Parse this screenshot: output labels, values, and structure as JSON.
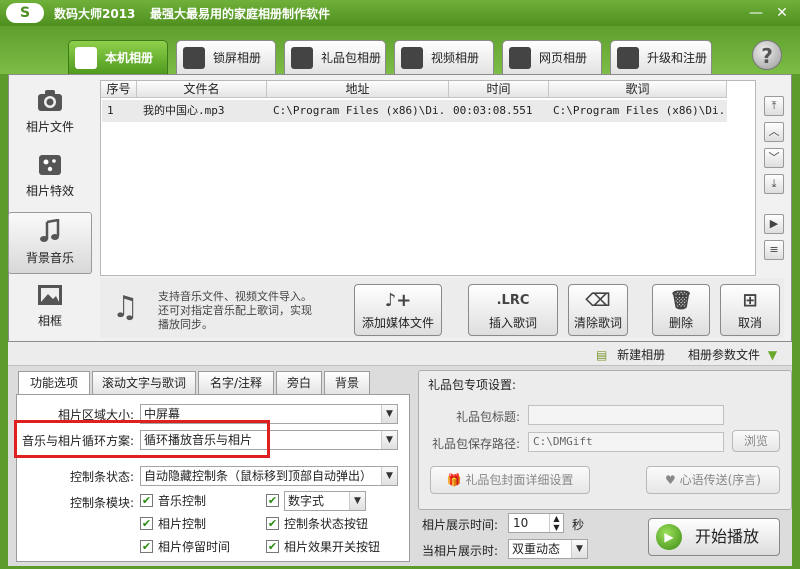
{
  "window": {
    "title": "数码大师2013",
    "slogan": "最强大最易用的家庭相册制作软件",
    "logo_text": "S",
    "minimize": "—",
    "close": "✕"
  },
  "main_tabs": [
    {
      "label": "本机相册",
      "icon": "user-photo-icon"
    },
    {
      "label": "锁屏相册",
      "icon": "monitor-icon"
    },
    {
      "label": "礼品包相册",
      "icon": "gift-icon"
    },
    {
      "label": "视频相册",
      "icon": "film-icon"
    },
    {
      "label": "网页相册",
      "icon": "ie-icon"
    },
    {
      "label": "升级和注册",
      "icon": "globe-icon"
    }
  ],
  "help_label": "?",
  "sidebar": [
    {
      "label": "相片文件",
      "icon": "camera-icon"
    },
    {
      "label": "相片特效",
      "icon": "effects-icon"
    },
    {
      "label": "背景音乐",
      "icon": "music-note-icon"
    },
    {
      "label": "相框",
      "icon": "picture-frame-icon"
    }
  ],
  "table": {
    "columns": [
      "序号",
      "文件名",
      "地址",
      "时间",
      "歌词"
    ],
    "rows": [
      [
        "1",
        "我的中国心.mp3",
        "C:\\Program Files (x86)\\Di...",
        "00:03:08.551",
        "C:\\Program Files (x86)\\Di..."
      ]
    ]
  },
  "side_arrows": [
    "⤒",
    "︿",
    "﹀",
    "⤓",
    "▶",
    "≡"
  ],
  "info_text": [
    "支持音乐文件、视频文件导入。",
    "还可对指定音乐配上歌词，实现",
    "播放同步。"
  ],
  "actions": [
    {
      "label": "添加媒体文件",
      "icon": "add-music-icon",
      "glyph": "♪+"
    },
    {
      "label": "插入歌词",
      "icon": "lrc-icon",
      "glyph": ".LRC"
    },
    {
      "label": "清除歌词",
      "icon": "eraser-icon",
      "glyph": "⌫"
    },
    {
      "label": "删除",
      "icon": "trash-icon",
      "glyph": "🗑"
    },
    {
      "label": "取消",
      "icon": "grid-icon",
      "glyph": "⊞"
    }
  ],
  "toolstrip": {
    "new_album": "新建相册",
    "album_params": "相册参数文件"
  },
  "sub_tabs": [
    "功能选项",
    "滚动文字与歌词",
    "名字/注释",
    "旁白",
    "背景"
  ],
  "options": {
    "photo_area_label": "相片区域大小:",
    "photo_area_value": "中屏幕",
    "loop_label": "音乐与相片循环方案:",
    "loop_value": "循环播放音乐与相片",
    "control_state_label": "控制条状态:",
    "control_state_value": "自动隐藏控制条（鼠标移到顶部自动弹出）",
    "control_module_label": "控制条模块:",
    "checks": [
      "音乐控制",
      "相片控制",
      "相片停留时间",
      "控制条状态按钮",
      "相片效果开关按钮"
    ],
    "time_format_value": "数字式"
  },
  "gift": {
    "heading": "礼品包专项设置:",
    "title_label": "礼品包标题:",
    "title_value": "",
    "path_label": "礼品包保存路径:",
    "path_value": "C:\\DMGift",
    "browse": "浏览",
    "cover_button": "礼品包封面详细设置",
    "message_button": "心语传送(序言)"
  },
  "playback": {
    "display_time_label": "相片展示时间:",
    "display_time_value": "10",
    "unit": "秒",
    "when_label": "当相片展示时:",
    "when_value": "双重动态",
    "start_button": "开始播放"
  }
}
